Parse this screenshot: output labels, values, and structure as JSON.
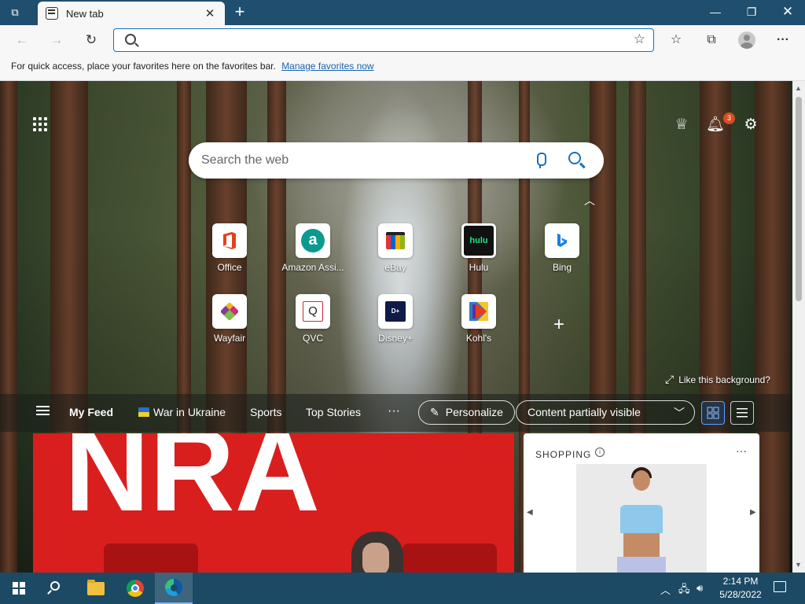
{
  "browser": {
    "tab_title": "New tab",
    "address_value": "",
    "favorites_bar_text": "For quick access, place your favorites here on the favorites bar.",
    "favorites_bar_link": "Manage favorites now"
  },
  "page": {
    "search_placeholder": "Search the web",
    "notification_count": "3",
    "tiles": [
      {
        "label": "Office",
        "icon": "office-logo"
      },
      {
        "label": "Amazon Assi...",
        "icon": "amazon-logo"
      },
      {
        "label": "eBay",
        "icon": "ebay-logo"
      },
      {
        "label": "Hulu",
        "icon": "hulu-logo",
        "icon_text": "hulu"
      },
      {
        "label": "Bing",
        "icon": "bing-logo"
      },
      {
        "label": "Wayfair",
        "icon": "wayfair-logo"
      },
      {
        "label": "QVC",
        "icon": "qvc-logo"
      },
      {
        "label": "Disney+",
        "icon": "disney-logo"
      },
      {
        "label": "Kohl's",
        "icon": "kohls-logo"
      }
    ],
    "like_background": "Like this background?",
    "feed": {
      "my_feed": "My Feed",
      "war_in_ukraine": "War in Ukraine",
      "sports": "Sports",
      "top_stories": "Top Stories",
      "more": "···",
      "personalize": "Personalize",
      "content_visibility": "Content partially visible"
    },
    "news_image_text": "NRA",
    "shopping": {
      "title": "SHOPPING"
    }
  },
  "taskbar": {
    "time": "2:14 PM",
    "date": "5/28/2022"
  },
  "colors": {
    "titlebar": "#1f4e6e",
    "accent": "#1a6fb5",
    "taskbar": "#1c4a64",
    "news_red": "#d91e1e"
  }
}
